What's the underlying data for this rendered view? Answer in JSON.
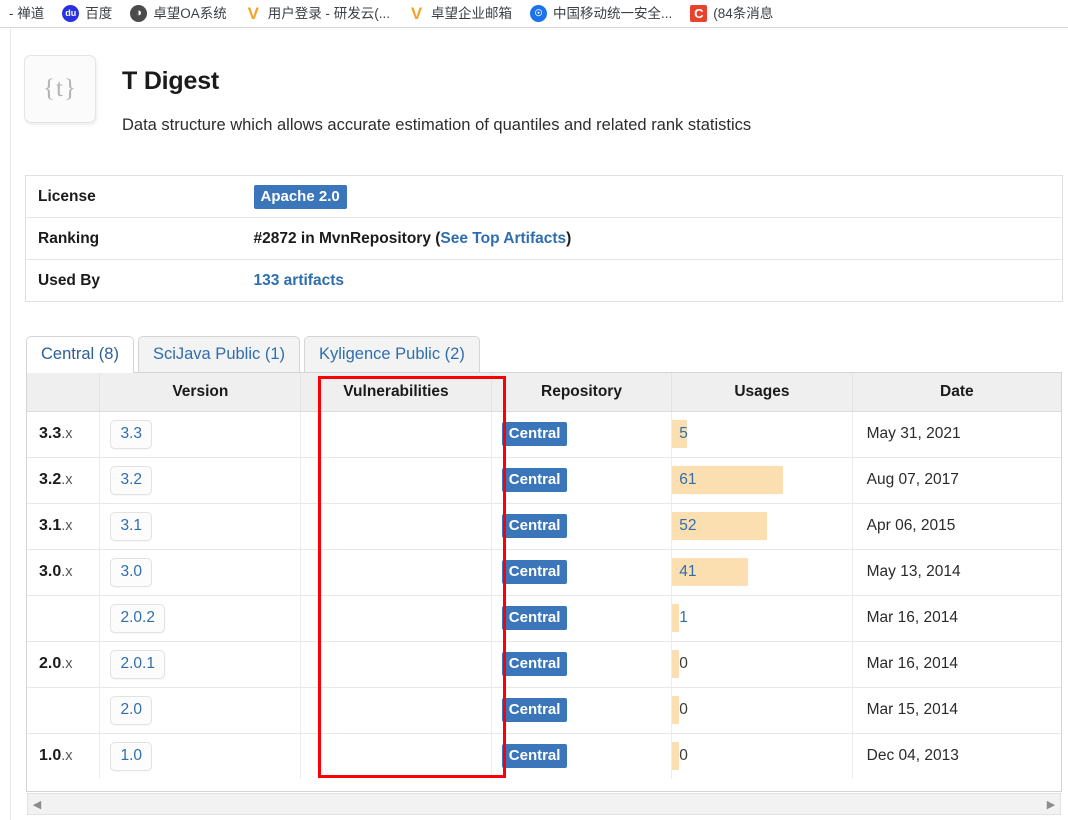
{
  "browser": {
    "bookmarks": [
      {
        "label": "- 禅道",
        "icon": "none"
      },
      {
        "label": "百度",
        "icon": "baidu-icon",
        "glyph": "du"
      },
      {
        "label": "卓望OA系统",
        "icon": "globe-icon",
        "glyph": "◑"
      },
      {
        "label": "用户登录 - 研发云(...",
        "icon": "v-mark-icon",
        "glyph": "V"
      },
      {
        "label": "卓望企业邮箱",
        "icon": "v-mark-icon",
        "glyph": "V"
      },
      {
        "label": "中国移动统一安全...",
        "icon": "shield-icon",
        "glyph": "☉"
      },
      {
        "label": "(84条消息",
        "icon": "csdn-icon",
        "glyph": "C"
      }
    ]
  },
  "project": {
    "logo_text": "{t}",
    "title": "T Digest",
    "description": "Data structure which allows accurate estimation of quantiles and related rank statistics"
  },
  "info": {
    "rows": [
      {
        "key": "License",
        "type": "badge",
        "value": "Apache 2.0"
      },
      {
        "key": "Ranking",
        "type": "ranking",
        "prefix": "#2872 in MvnRepository (",
        "link": "See Top Artifacts",
        "suffix": ")"
      },
      {
        "key": "Used By",
        "type": "link",
        "value": "133 artifacts"
      }
    ]
  },
  "tabs": [
    {
      "label": "Central (8)",
      "active": true
    },
    {
      "label": "SciJava Public (1)",
      "active": false
    },
    {
      "label": "Kyligence Public (2)",
      "active": false
    }
  ],
  "table": {
    "headers": [
      "",
      "Version",
      "Vulnerabilities",
      "Repository",
      "Usages",
      "Date"
    ],
    "rows": [
      {
        "major": "3.3",
        "major_suffix": ".x",
        "version": "3.3",
        "vulnerabilities": "",
        "repository": "Central",
        "usages": "5",
        "usages_bar_pct": 8,
        "date": "May 31, 2021"
      },
      {
        "major": "3.2",
        "major_suffix": ".x",
        "version": "3.2",
        "vulnerabilities": "",
        "repository": "Central",
        "usages": "61",
        "usages_bar_pct": 62,
        "date": "Aug 07, 2017"
      },
      {
        "major": "3.1",
        "major_suffix": ".x",
        "version": "3.1",
        "vulnerabilities": "",
        "repository": "Central",
        "usages": "52",
        "usages_bar_pct": 53,
        "date": "Apr 06, 2015"
      },
      {
        "major": "3.0",
        "major_suffix": ".x",
        "version": "3.0",
        "vulnerabilities": "",
        "repository": "Central",
        "usages": "41",
        "usages_bar_pct": 42,
        "date": "May 13, 2014"
      },
      {
        "major": "",
        "major_suffix": "",
        "version": "2.0.2",
        "vulnerabilities": "",
        "repository": "Central",
        "usages": "1",
        "usages_bar_pct": 4,
        "date": "Mar 16, 2014"
      },
      {
        "major": "2.0",
        "major_suffix": ".x",
        "version": "2.0.1",
        "vulnerabilities": "",
        "repository": "Central",
        "usages": "0",
        "usages_bar_pct": 4,
        "date": "Mar 16, 2014"
      },
      {
        "major": "",
        "major_suffix": "",
        "version": "2.0",
        "vulnerabilities": "",
        "repository": "Central",
        "usages": "0",
        "usages_bar_pct": 4,
        "date": "Mar 15, 2014"
      },
      {
        "major": "1.0",
        "major_suffix": ".x",
        "version": "1.0",
        "vulnerabilities": "",
        "repository": "Central",
        "usages": "0",
        "usages_bar_pct": 4,
        "date": "Dec 04, 2013"
      }
    ]
  },
  "scrollbar": {
    "left_arrow": "◀",
    "right_arrow": "▶"
  },
  "annotation": {
    "color": "#fb0007",
    "target": "Vulnerabilities"
  }
}
